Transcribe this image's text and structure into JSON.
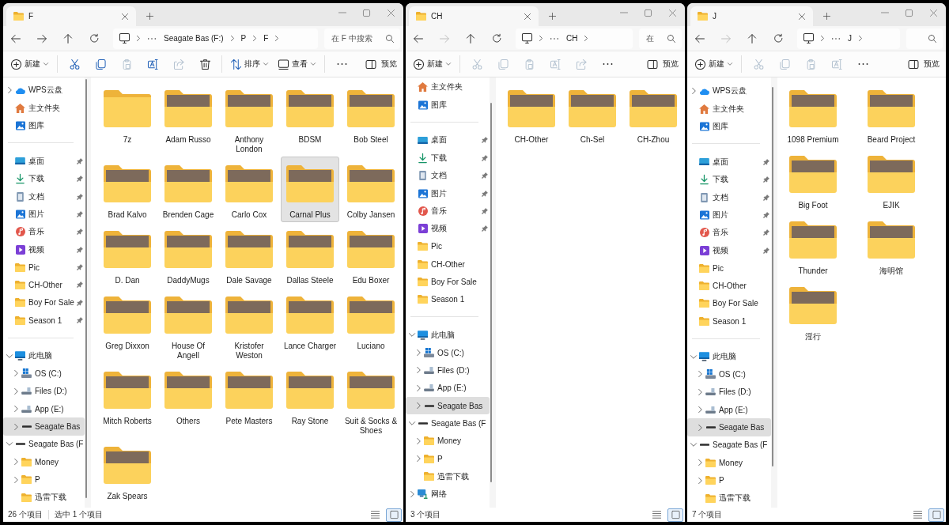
{
  "windows": [
    {
      "tab": {
        "title": "F"
      },
      "nav": [
        {
          "kind": "back",
          "disabled": false
        },
        {
          "kind": "forward",
          "disabled": false
        },
        {
          "kind": "up",
          "disabled": false
        },
        {
          "kind": "refresh",
          "disabled": false
        }
      ],
      "breadcrumb": [
        "Seagate Bas (F:)",
        "P",
        "F"
      ],
      "search": {
        "placeholder": "在 F 中搜索"
      },
      "command_groups": [
        [
          {
            "kind": "new",
            "label": "新建",
            "menu": true,
            "disabled": false
          }
        ],
        [
          {
            "kind": "cut",
            "disabled": false
          },
          {
            "kind": "copy",
            "disabled": false
          },
          {
            "kind": "paste",
            "disabled": true
          },
          {
            "kind": "rename",
            "disabled": false
          },
          {
            "kind": "share",
            "disabled": true
          },
          {
            "kind": "delete",
            "disabled": false
          }
        ],
        [
          {
            "kind": "sort",
            "label": "排序",
            "menu": true,
            "disabled": false
          },
          {
            "kind": "view",
            "label": "查看",
            "menu": true,
            "disabled": false
          }
        ],
        [
          {
            "kind": "more",
            "disabled": false
          }
        ]
      ],
      "preview_button": {
        "label": "预览"
      },
      "sidebar": {
        "sections": [
          {
            "items": [
              {
                "label": "WPS云盘",
                "kind": "cloud",
                "expanded": false,
                "selected": false
              },
              {
                "label": "主文件夹",
                "kind": "home",
                "selected": false
              },
              {
                "label": "图库",
                "kind": "gallery",
                "selected": false
              }
            ]
          },
          {
            "items": [
              {
                "label": "桌面",
                "kind": "desktop",
                "pinned": true,
                "selected": false
              },
              {
                "label": "下载",
                "kind": "download",
                "pinned": true,
                "selected": false
              },
              {
                "label": "文档",
                "kind": "documents",
                "pinned": true,
                "selected": false
              },
              {
                "label": "图片",
                "kind": "pictures",
                "pinned": true,
                "selected": false
              },
              {
                "label": "音乐",
                "kind": "music",
                "pinned": true,
                "selected": false
              },
              {
                "label": "视频",
                "kind": "video",
                "pinned": true,
                "selected": false
              },
              {
                "label": "Pic",
                "kind": "folder",
                "pinned": true,
                "selected": false
              },
              {
                "label": "CH-Other",
                "kind": "folder",
                "pinned": true,
                "selected": false
              },
              {
                "label": "Boy For Sale",
                "kind": "folder",
                "pinned": true,
                "selected": false
              },
              {
                "label": "Season 1",
                "kind": "folder",
                "pinned": true,
                "selected": false
              }
            ]
          },
          {
            "items": [
              {
                "label": "此电脑",
                "kind": "pc",
                "expanded": true,
                "selected": false,
                "children": [
                  {
                    "label": "OS (C:)",
                    "kind": "system_drive",
                    "expanded": false,
                    "selected": false
                  },
                  {
                    "label": "Files (D:)",
                    "kind": "drive",
                    "expanded": false,
                    "selected": false
                  },
                  {
                    "label": "App (E:)",
                    "kind": "drive",
                    "expanded": false,
                    "selected": false
                  },
                  {
                    "label": "Seagate Bas",
                    "kind": "removable_drive",
                    "expanded": false,
                    "selected": true
                  }
                ]
              },
              {
                "label": "Seagate Bas (F",
                "kind": "removable_drive",
                "expanded": true,
                "selected": false,
                "children": [
                  {
                    "label": "Money",
                    "kind": "folder",
                    "expanded": false,
                    "selected": false
                  },
                  {
                    "label": "P",
                    "kind": "folder",
                    "expanded": false,
                    "selected": false
                  },
                  {
                    "label": "迅雷下载",
                    "kind": "folder",
                    "selected": false
                  }
                ]
              }
            ]
          }
        ]
      },
      "folders": [
        {
          "name": "7z",
          "has_preview": false,
          "selected": false
        },
        {
          "name": "Adam Russo",
          "has_preview": true,
          "selected": false
        },
        {
          "name": "Anthony London",
          "has_preview": true,
          "selected": false
        },
        {
          "name": "BDSM",
          "has_preview": true,
          "selected": false
        },
        {
          "name": "Bob Steel",
          "has_preview": true,
          "selected": false
        },
        {
          "name": "Brad Kalvo",
          "has_preview": true,
          "selected": false
        },
        {
          "name": "Brenden Cage",
          "has_preview": true,
          "selected": false
        },
        {
          "name": "Carlo Cox",
          "has_preview": true,
          "selected": false
        },
        {
          "name": "Carnal Plus",
          "has_preview": true,
          "selected": true
        },
        {
          "name": "Colby Jansen",
          "has_preview": true,
          "selected": false
        },
        {
          "name": "D. Dan",
          "has_preview": true,
          "selected": false
        },
        {
          "name": "DaddyMugs",
          "has_preview": true,
          "selected": false
        },
        {
          "name": "Dale Savage",
          "has_preview": true,
          "selected": false
        },
        {
          "name": "Dallas Steele",
          "has_preview": true,
          "selected": false
        },
        {
          "name": "Edu Boxer",
          "has_preview": true,
          "selected": false
        },
        {
          "name": "Greg Dixxon",
          "has_preview": true,
          "selected": false
        },
        {
          "name": "House Of Angell",
          "has_preview": true,
          "selected": false
        },
        {
          "name": "Kristofer Weston",
          "has_preview": true,
          "selected": false
        },
        {
          "name": "Lance Charger",
          "has_preview": true,
          "selected": false
        },
        {
          "name": "Luciano",
          "has_preview": true,
          "selected": false
        },
        {
          "name": "Mitch Roberts",
          "has_preview": true,
          "selected": false
        },
        {
          "name": "Others",
          "has_preview": true,
          "selected": false
        },
        {
          "name": "Pete Masters",
          "has_preview": true,
          "selected": false
        },
        {
          "name": "Ray Stone",
          "has_preview": true,
          "selected": false
        },
        {
          "name": "Suit & Socks & Shoes",
          "has_preview": true,
          "selected": false
        },
        {
          "name": "Zak Spears",
          "has_preview": true,
          "selected": false
        }
      ],
      "status_bar": {
        "item_count": "26 个项目",
        "selection": "选中 1 个项目"
      },
      "view_buttons": [
        {
          "kind": "details",
          "selected": false
        },
        {
          "kind": "large_icons",
          "selected": true
        }
      ]
    },
    {
      "tab": {
        "title": "CH"
      },
      "nav": [
        {
          "kind": "back",
          "disabled": false
        },
        {
          "kind": "forward",
          "disabled": true
        },
        {
          "kind": "up",
          "disabled": false
        },
        {
          "kind": "refresh",
          "disabled": false
        }
      ],
      "breadcrumb": [
        "CH"
      ],
      "search": {
        "placeholder": "在"
      },
      "command_groups": [
        [
          {
            "kind": "new",
            "label": "新建",
            "menu": true,
            "disabled": false
          }
        ],
        [
          {
            "kind": "cut",
            "disabled": true
          },
          {
            "kind": "copy",
            "disabled": true
          },
          {
            "kind": "paste",
            "disabled": true
          },
          {
            "kind": "rename",
            "disabled": true
          },
          {
            "kind": "share",
            "disabled": true
          },
          {
            "kind": "more",
            "disabled": false
          }
        ]
      ],
      "preview_button": {
        "label": "预览"
      },
      "sidebar": {
        "sections": [
          {
            "items": [
              {
                "label": "主文件夹",
                "kind": "home",
                "selected": false
              },
              {
                "label": "图库",
                "kind": "gallery",
                "selected": false
              }
            ]
          },
          {
            "items": [
              {
                "label": "桌面",
                "kind": "desktop",
                "pinned": true,
                "selected": false
              },
              {
                "label": "下载",
                "kind": "download",
                "pinned": true,
                "selected": false
              },
              {
                "label": "文档",
                "kind": "documents",
                "pinned": true,
                "selected": false
              },
              {
                "label": "图片",
                "kind": "pictures",
                "pinned": true,
                "selected": false
              },
              {
                "label": "音乐",
                "kind": "music",
                "pinned": true,
                "selected": false
              },
              {
                "label": "视频",
                "kind": "video",
                "pinned": true,
                "selected": false
              },
              {
                "label": "Pic",
                "kind": "folder",
                "pinned": false,
                "selected": false
              },
              {
                "label": "CH-Other",
                "kind": "folder",
                "pinned": false,
                "selected": false
              },
              {
                "label": "Boy For Sale",
                "kind": "folder",
                "pinned": false,
                "selected": false
              },
              {
                "label": "Season 1",
                "kind": "folder",
                "pinned": false,
                "selected": false
              }
            ]
          },
          {
            "items": [
              {
                "label": "此电脑",
                "kind": "pc",
                "expanded": true,
                "selected": false,
                "children": [
                  {
                    "label": "OS (C:)",
                    "kind": "system_drive",
                    "expanded": false,
                    "selected": false
                  },
                  {
                    "label": "Files (D:)",
                    "kind": "drive",
                    "expanded": false,
                    "selected": false
                  },
                  {
                    "label": "App (E:)",
                    "kind": "drive",
                    "expanded": false,
                    "selected": false
                  },
                  {
                    "label": "Seagate Bas",
                    "kind": "removable_drive",
                    "expanded": false,
                    "selected": true
                  }
                ]
              },
              {
                "label": "Seagate Bas (F",
                "kind": "removable_drive",
                "expanded": true,
                "selected": false,
                "children": [
                  {
                    "label": "Money",
                    "kind": "folder",
                    "expanded": false,
                    "selected": false
                  },
                  {
                    "label": "P",
                    "kind": "folder",
                    "expanded": false,
                    "selected": false
                  },
                  {
                    "label": "迅雷下载",
                    "kind": "folder",
                    "selected": false
                  }
                ]
              },
              {
                "label": "网络",
                "kind": "network",
                "expanded": false,
                "selected": false
              }
            ]
          }
        ]
      },
      "folders": [
        {
          "name": "CH-Other",
          "has_preview": true,
          "selected": false
        },
        {
          "name": "Ch-Sel",
          "has_preview": true,
          "selected": false
        },
        {
          "name": "CH-Zhou",
          "has_preview": true,
          "selected": false
        }
      ],
      "status_bar": {
        "item_count": "3 个项目"
      },
      "view_buttons": [
        {
          "kind": "details",
          "selected": false
        },
        {
          "kind": "large_icons",
          "selected": true
        }
      ]
    },
    {
      "tab": {
        "title": "J"
      },
      "nav": [
        {
          "kind": "back",
          "disabled": false
        },
        {
          "kind": "forward",
          "disabled": true
        },
        {
          "kind": "up",
          "disabled": false
        },
        {
          "kind": "refresh",
          "disabled": false
        }
      ],
      "breadcrumb": [
        "J"
      ],
      "command_groups": [
        [
          {
            "kind": "new",
            "label": "新建",
            "menu": true,
            "disabled": false
          }
        ],
        [
          {
            "kind": "cut",
            "disabled": true
          },
          {
            "kind": "copy",
            "disabled": true
          },
          {
            "kind": "paste",
            "disabled": true
          },
          {
            "kind": "rename",
            "disabled": true
          },
          {
            "kind": "more",
            "disabled": false
          }
        ]
      ],
      "preview_button": {
        "label": "预览"
      },
      "sidebar": {
        "sections": [
          {
            "items": [
              {
                "label": "WPS云盘",
                "kind": "cloud",
                "expanded": false,
                "selected": false
              },
              {
                "label": "主文件夹",
                "kind": "home",
                "selected": false
              },
              {
                "label": "图库",
                "kind": "gallery",
                "selected": false
              }
            ]
          },
          {
            "items": [
              {
                "label": "桌面",
                "kind": "desktop",
                "pinned": true,
                "selected": false
              },
              {
                "label": "下载",
                "kind": "download",
                "pinned": true,
                "selected": false
              },
              {
                "label": "文档",
                "kind": "documents",
                "pinned": true,
                "selected": false
              },
              {
                "label": "图片",
                "kind": "pictures",
                "pinned": true,
                "selected": false
              },
              {
                "label": "音乐",
                "kind": "music",
                "pinned": true,
                "selected": false
              },
              {
                "label": "视频",
                "kind": "video",
                "pinned": true,
                "selected": false
              },
              {
                "label": "Pic",
                "kind": "folder",
                "pinned": false,
                "selected": false
              },
              {
                "label": "CH-Other",
                "kind": "folder",
                "pinned": false,
                "selected": false
              },
              {
                "label": "Boy For Sale",
                "kind": "folder",
                "pinned": false,
                "selected": false
              },
              {
                "label": "Season 1",
                "kind": "folder",
                "pinned": false,
                "selected": false
              }
            ]
          },
          {
            "items": [
              {
                "label": "此电脑",
                "kind": "pc",
                "expanded": true,
                "selected": false,
                "children": [
                  {
                    "label": "OS (C:)",
                    "kind": "system_drive",
                    "expanded": false,
                    "selected": false
                  },
                  {
                    "label": "Files (D:)",
                    "kind": "drive",
                    "expanded": false,
                    "selected": false
                  },
                  {
                    "label": "App (E:)",
                    "kind": "drive",
                    "expanded": false,
                    "selected": false
                  },
                  {
                    "label": "Seagate Bas",
                    "kind": "removable_drive",
                    "expanded": false,
                    "selected": true
                  }
                ]
              },
              {
                "label": "Seagate Bas (F",
                "kind": "removable_drive",
                "expanded": true,
                "selected": false,
                "children": [
                  {
                    "label": "Money",
                    "kind": "folder",
                    "expanded": false,
                    "selected": false
                  },
                  {
                    "label": "P",
                    "kind": "folder",
                    "expanded": false,
                    "selected": false
                  },
                  {
                    "label": "迅雷下载",
                    "kind": "folder",
                    "selected": false
                  }
                ]
              }
            ]
          }
        ]
      },
      "folders": [
        {
          "name": "1098 Premium",
          "has_preview": true,
          "selected": false
        },
        {
          "name": "Beard Project",
          "has_preview": true,
          "selected": false
        },
        {
          "name": "Big Foot",
          "has_preview": true,
          "selected": false
        },
        {
          "name": "EJIK",
          "has_preview": true,
          "selected": false
        },
        {
          "name": "Thunder",
          "has_preview": true,
          "selected": false
        },
        {
          "name": "海明馆",
          "has_preview": true,
          "selected": false
        },
        {
          "name": "淫行",
          "has_preview": true,
          "selected": false
        }
      ],
      "status_bar": {
        "item_count": "7 个项目"
      },
      "view_buttons": [
        {
          "kind": "details",
          "selected": false
        },
        {
          "kind": "large_icons",
          "selected": true
        }
      ]
    }
  ]
}
